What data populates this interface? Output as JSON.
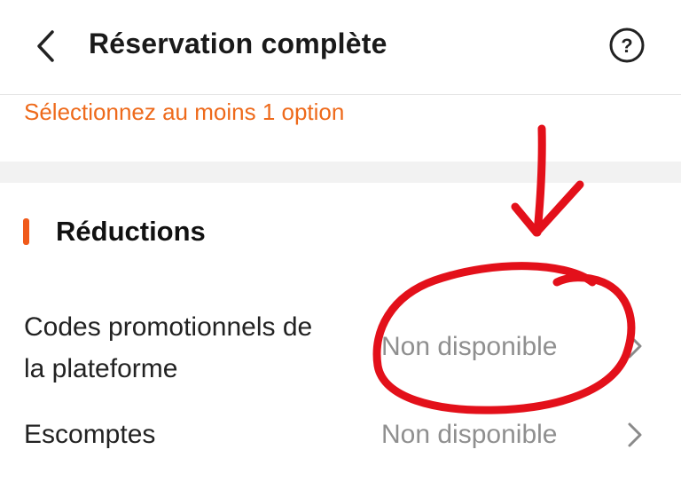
{
  "header": {
    "title": "Réservation complète",
    "back_icon": "chevron-left-icon",
    "help_icon": "question-circle-icon"
  },
  "hint": "Sélectionnez au moins 1 option",
  "section": {
    "title": "Réductions",
    "accent_color": "#f05a1a"
  },
  "rows": [
    {
      "label_line1": "Codes promotionnels de",
      "label_line2": "la plateforme",
      "value": "Non disponible"
    },
    {
      "label": "Escomptes",
      "value": "Non disponible"
    }
  ],
  "colors": {
    "hint": "#ee6a1b",
    "value_text": "#8f8f8f",
    "annotation": "#e3101a"
  }
}
